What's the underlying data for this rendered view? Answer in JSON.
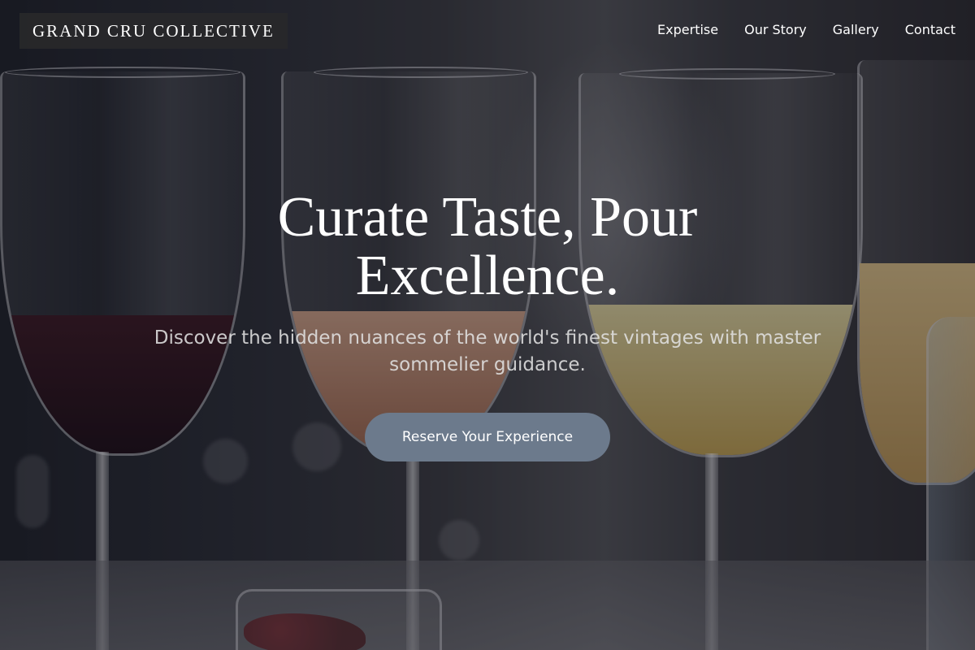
{
  "header": {
    "brand": "GRAND CRU COLLECTIVE",
    "nav": [
      {
        "label": "Expertise"
      },
      {
        "label": "Our Story"
      },
      {
        "label": "Gallery"
      },
      {
        "label": "Contact"
      }
    ]
  },
  "hero": {
    "headline": "Curate Taste, Pour Excellence.",
    "subheadline": "Discover the hidden nuances of the world's finest vintages with master sommelier guidance.",
    "cta_label": "Reserve Your Experience",
    "cta_color": "#6c7a8c"
  }
}
